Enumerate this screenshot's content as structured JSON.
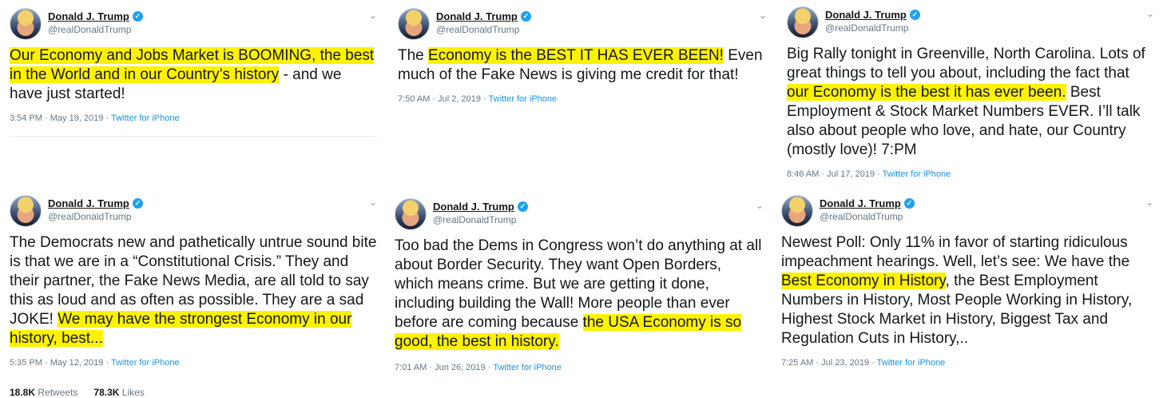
{
  "author": {
    "name": "Donald J. Trump",
    "handle": "@realDonaldTrump",
    "verified_glyph": "✓",
    "menu_glyph": "⌄"
  },
  "tweets": [
    {
      "segments": [
        {
          "text": "Our Economy and Jobs Market is BOOMING, the best in the World and in our Country’s history",
          "hl": true
        },
        {
          "text": " - and we have just started!",
          "hl": false
        }
      ],
      "time": "3:54 PM · May 19, 2019",
      "source": "Twitter for iPhone"
    },
    {
      "segments": [
        {
          "text": "The ",
          "hl": false
        },
        {
          "text": "Economy is the BEST IT HAS EVER BEEN!",
          "hl": true
        },
        {
          "text": " Even much of the Fake News is giving me credit for that!",
          "hl": false
        }
      ],
      "time": "7:50 AM · Jul 2, 2019",
      "source": "Twitter for iPhone"
    },
    {
      "segments": [
        {
          "text": "Big Rally tonight in Greenville, North Carolina. Lots of great things to tell you about, including the fact that ",
          "hl": false
        },
        {
          "text": "our Economy is the best it has ever been.",
          "hl": true
        },
        {
          "text": " Best Employment & Stock Market Numbers EVER. I’ll talk also about people who love, and hate, our Country (mostly love)!  7:PM",
          "hl": false
        }
      ],
      "time": "8:46 AM · Jul 17, 2019",
      "source": "Twitter for iPhone"
    },
    {
      "segments": [
        {
          "text": "The Democrats new and pathetically untrue sound bite is that we are in a “Constitutional Crisis.” They and their partner, the Fake News Media, are all told to say this as loud and as often as possible. They are a sad JOKE! ",
          "hl": false
        },
        {
          "text": "We may have the strongest Economy in our history, best...",
          "hl": true
        }
      ],
      "time": "5:35 PM · May 12, 2019",
      "source": "Twitter for iPhone",
      "retweets_count": "18.8K",
      "retweets_label": "Retweets",
      "likes_count": "78.3K",
      "likes_label": "Likes"
    },
    {
      "segments": [
        {
          "text": "Too bad the Dems in Congress won’t do anything at all about Border Security. They want Open Borders, which means crime. But we are getting it done, including building the Wall! More people than ever before are coming because ",
          "hl": false
        },
        {
          "text": "the USA Economy is so good, the best in history.",
          "hl": true
        }
      ],
      "time": "7:01 AM · Jun 26, 2019",
      "source": "Twitter for iPhone"
    },
    {
      "segments": [
        {
          "text": "Newest Poll: Only 11% in favor of starting ridiculous impeachment hearings. Well, let’s see: We have the ",
          "hl": false
        },
        {
          "text": "Best Economy in History",
          "hl": true
        },
        {
          "text": ", the Best Employment Numbers in History, Most People Working in History, Highest Stock Market in History, Biggest Tax and Regulation Cuts in History,..",
          "hl": false
        }
      ],
      "time": "7:25 AM · Jul 23, 2019",
      "source": "Twitter for iPhone"
    }
  ],
  "colors": {
    "highlight": "#fff200",
    "link": "#1b95e0",
    "verified": "#1da1f2",
    "muted": "#657786"
  }
}
